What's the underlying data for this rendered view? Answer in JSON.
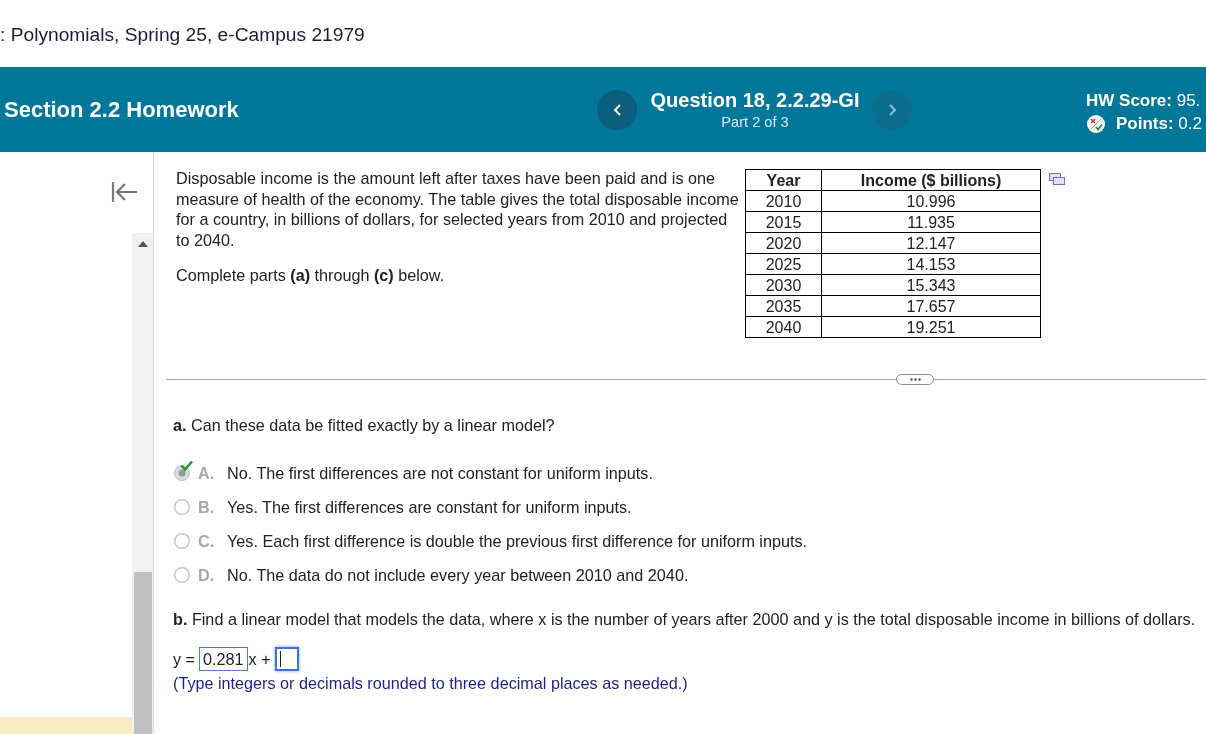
{
  "page_title": ": Polynomials, Spring 25, e-Campus 21979",
  "header": {
    "section_title": "Section 2.2 Homework",
    "previous_button": {
      "disabled": false
    },
    "question": {
      "title": "Question 18, 2.2.29-GI",
      "part": "Part 2 of 3"
    },
    "next_button": {
      "disabled": true
    },
    "score": {
      "hw_score": "**HW Score:** 95.",
      "points": "**Points:** 0.2"
    }
  },
  "problem": {
    "paragraphs": [
      "Disposable income is the amount left after taxes have been paid and is one measure of health of the economy. The table gives the total disposable income for a country, in billions of dollars, for selected years from 2010 and projected to 2040.",
      "Complete parts **(a)** through **(c)** below."
    ]
  },
  "data_table": {
    "columns": [
      "Year",
      "Income ($ billions)"
    ],
    "rows": [
      [
        "2010",
        "10.996"
      ],
      [
        "2015",
        "11.935"
      ],
      [
        "2020",
        "12.147"
      ],
      [
        "2025",
        "14.153"
      ],
      [
        "2030",
        "15.343"
      ],
      [
        "2035",
        "17.657"
      ],
      [
        "2040",
        "19.251"
      ]
    ]
  },
  "part_a": {
    "prompt": "**a.** Can these data be fitted exactly by a linear model?",
    "options": [
      {
        "letter": "A.",
        "text": "No. The first differences are not constant for uniform inputs.",
        "selected": true,
        "correct": true
      },
      {
        "letter": "B.",
        "text": "Yes. The first differences are constant for uniform inputs.",
        "selected": false,
        "correct": false
      },
      {
        "letter": "C.",
        "text": "Yes. Each first difference is double the previous first difference for uniform inputs.",
        "selected": false,
        "correct": false
      },
      {
        "letter": "D.",
        "text": "No. The data do not include every year between 2010 and 2040.",
        "selected": false,
        "correct": false
      }
    ]
  },
  "part_b": {
    "prompt": "**b.** Find a linear model that models the data, where x is the number of years after 2000 and y is the total disposable income in billions of dollars.",
    "equation": [
      {
        "kind": "text",
        "text": "y ="
      },
      {
        "kind": "input",
        "value": "0.281",
        "focused": false
      },
      {
        "kind": "text",
        "text": "x +"
      },
      {
        "kind": "input",
        "focused": true
      }
    ],
    "hint": "(Type integers or decimals rounded to three decimal places as needed.)"
  }
}
